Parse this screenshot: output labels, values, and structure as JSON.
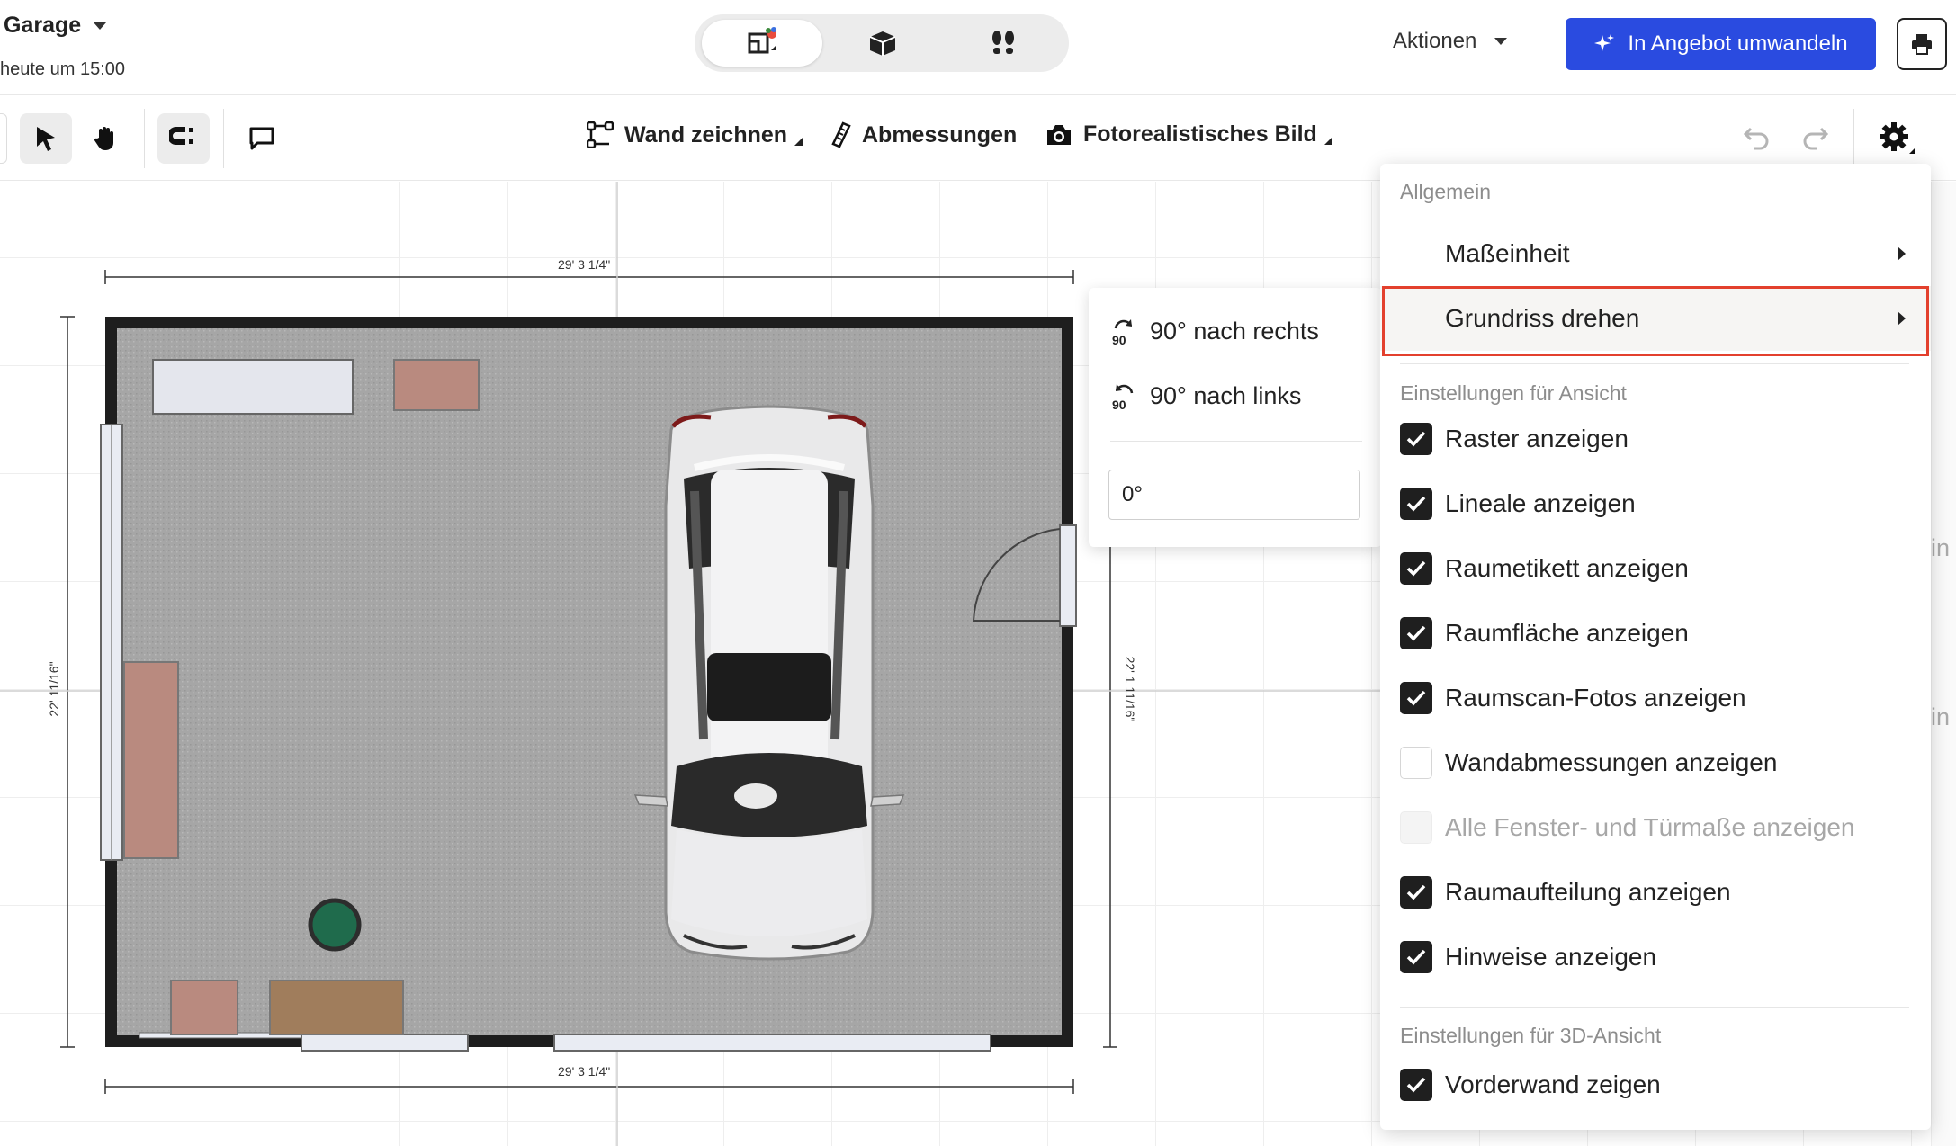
{
  "header": {
    "project_title": "Garage",
    "project_subtitle": "heute um 15:00",
    "actions_label": "Aktionen",
    "convert_label": "In Angebot umwandeln"
  },
  "toolbar": {
    "wall_tool": "Wand zeichnen",
    "dimensions_tool": "Abmessungen",
    "photo_tool": "Fotorealistisches Bild"
  },
  "plan": {
    "width_label_top": "29' 3 1/4\"",
    "width_label_bottom": "29' 3 1/4\"",
    "height_label_left": "22' 11/16\"",
    "height_label_right": "22' 1 11/16\""
  },
  "rotate_menu": {
    "rotate_right": "90° nach rechts",
    "rotate_left": "90° nach links",
    "icon_text": "90",
    "angle_value": "0°"
  },
  "settings_menu": {
    "section_general": "Allgemein",
    "unit_label": "Maßeinheit",
    "rotate_label": "Grundriss drehen",
    "section_view": "Einstellungen für Ansicht",
    "view_options": [
      {
        "label": "Raster anzeigen",
        "checked": true
      },
      {
        "label": "Lineale anzeigen",
        "checked": true
      },
      {
        "label": "Raumetikett anzeigen",
        "checked": true
      },
      {
        "label": "Raumfläche anzeigen",
        "checked": true
      },
      {
        "label": "Raumscan-Fotos anzeigen",
        "checked": true
      },
      {
        "label": "Wandabmessungen anzeigen",
        "checked": false
      },
      {
        "label": "Alle Fenster- und Türmaße anzeigen",
        "checked": false,
        "disabled": true
      },
      {
        "label": "Raumaufteilung anzeigen",
        "checked": true
      },
      {
        "label": "Hinweise anzeigen",
        "checked": true
      }
    ],
    "section_3d": "Einstellungen für 3D-Ansicht",
    "front_wall_label": "Vorderwand zeigen"
  },
  "right_edge": {
    "partial_1": "in",
    "partial_2": "in"
  },
  "colors": {
    "accent": "#2a4be0",
    "highlight_border": "#e3402d",
    "checkbox": "#1f1f1f",
    "floor": "#a9a9a9",
    "wall": "#1e1e1e"
  }
}
